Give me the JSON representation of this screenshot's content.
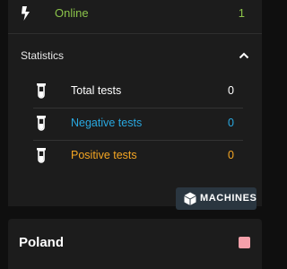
{
  "online": {
    "label": "Online",
    "count": "1",
    "color": "#8bc34a"
  },
  "statistics": {
    "title": "Statistics",
    "rows": [
      {
        "label": "Total tests",
        "value": "0",
        "color": "#ffffff"
      },
      {
        "label": "Negative tests",
        "value": "0",
        "color": "#29a8e0"
      },
      {
        "label": "Positive tests",
        "value": "0",
        "color": "#f5a623"
      }
    ]
  },
  "machines_button": {
    "label": "MACHINES"
  },
  "country": {
    "name": "Poland",
    "status_color": "#f4a0aa"
  },
  "icons": {
    "online": "lightning-bolt-icon",
    "collapse": "chevron-up-icon",
    "test": "test-tube-icon",
    "machines": "cube-icon"
  }
}
